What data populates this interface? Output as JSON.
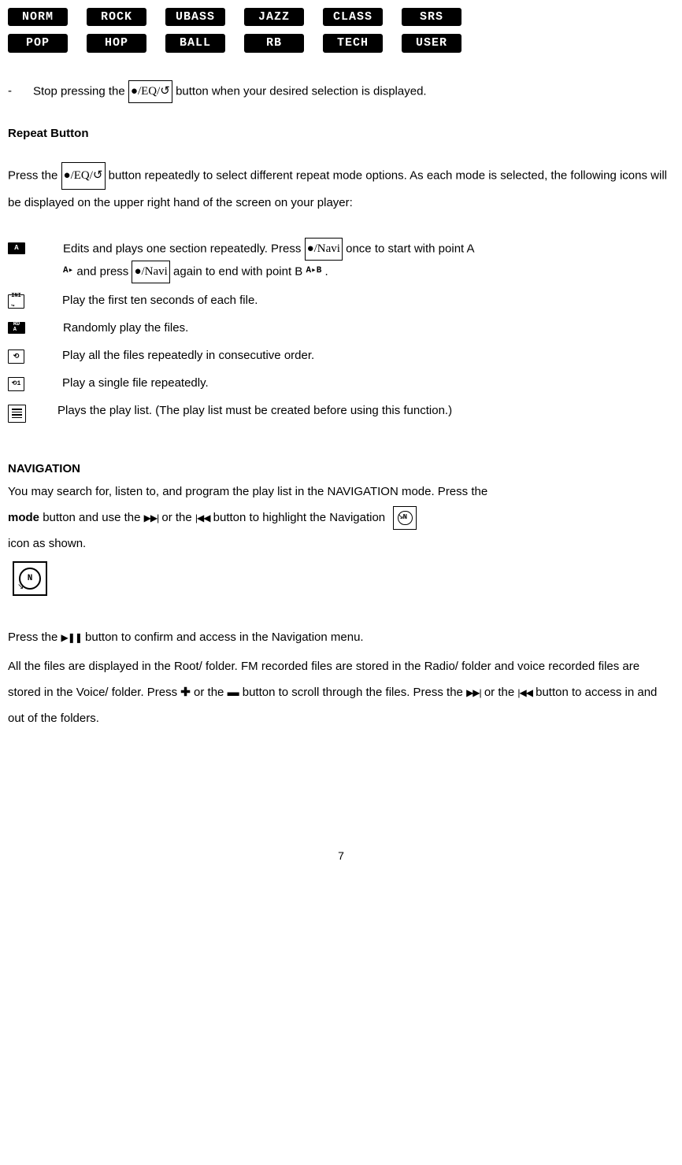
{
  "eq": {
    "row1": [
      "NORM",
      "ROCK",
      "UBASS",
      "JAZZ",
      "CLASS",
      "SRS"
    ],
    "row2": [
      "POP",
      "HOP",
      "BALL",
      "RB",
      "TECH",
      "USER"
    ]
  },
  "bullet": {
    "dash": "-",
    "t1": "Stop pressing the  ",
    "btn1": "●/EQ/↺",
    "t2": " button when your desired selection is displayed."
  },
  "repeat": {
    "heading": "Repeat Button",
    "intro_t1": "Press the  ",
    "intro_btn": "●/EQ/↺",
    "intro_t2": " button repeatedly to select different repeat mode options.   As each mode is selected, the following icons will be displayed on the upper right hand of the screen on your player:",
    "items": [
      {
        "icon_label": "A",
        "desc_t1": "Edits and plays one section repeatedly.   Press  ",
        "btn1": "●/Navi",
        "desc_t2": "  once to start with point A ",
        "ab1": "A▸",
        "desc_t3": "  and press  ",
        "btn2": "●/Navi",
        "desc_t4": "  again to end with point B  ",
        "ab2": "A▸B",
        "desc_t5": " ."
      },
      {
        "icon_label": "INI",
        "desc": "Play the first ten seconds of each file."
      },
      {
        "icon_label": "RD\nA",
        "desc": "Randomly play the files."
      },
      {
        "icon_label": "⟲",
        "desc": "Play all the files repeatedly in consecutive order."
      },
      {
        "icon_label": "⟲1",
        "desc": "Play a single file repeatedly."
      },
      {
        "icon_label": "LIST",
        "desc": "Plays the play list. (The play list must be created before using this function.)"
      }
    ]
  },
  "nav": {
    "heading": "NAVIGATION",
    "p1_t1": "You may search for, listen to, and program the play list in the NAVIGATION mode.   Press the ",
    "p1_mode": "mode",
    "p1_t2": "  button and use the  ",
    "fwd": "▶▶|",
    "p1_t3": "  or the  ",
    "rev": "|◀◀",
    "p1_t4": "  button to highlight the Navigation  ",
    "p1_t5": "icon as shown.",
    "p2_t1": "Press the  ",
    "play": "▶❚❚",
    "p2_t2": "  button to confirm and access in the Navigation menu.",
    "p3_t1": "All the files are displayed in the Root/ folder.   FM recorded files are stored in the Radio/ folder and voice recorded files are stored in the Voice/ folder.   Press  ",
    "plus": "✚",
    "p3_t2": "  or the   ",
    "minus": "▬",
    "p3_t3": "   button to scroll through the files.   Press the  ",
    "p3_t4": "  or the  ",
    "p3_t5": "  button to access in and out of the folders."
  },
  "page_number": "7"
}
